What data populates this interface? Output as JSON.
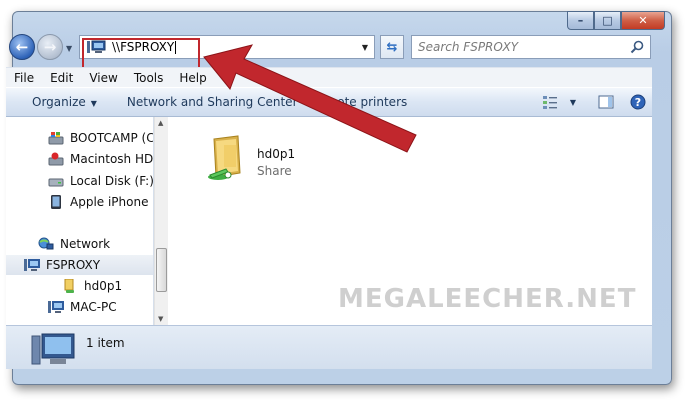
{
  "window": {
    "caption": {
      "minimize": "–",
      "maximize": "□",
      "close": "✕"
    }
  },
  "navigation": {
    "back_icon": "back-arrow-icon",
    "forward_icon": "forward-arrow-icon",
    "address_value": "\\\\FSPROXY",
    "search_placeholder": "Search FSPROXY"
  },
  "menu": [
    "File",
    "Edit",
    "View",
    "Tools",
    "Help"
  ],
  "commands": {
    "organize": "Organize",
    "network_sharing": "Network and Sharing Center",
    "remote_printers": "remote printers"
  },
  "sidebar": {
    "items": [
      {
        "label": "BOOTCAMP (C:)",
        "icon": "windows-drive-icon"
      },
      {
        "label": "Macintosh HD (E",
        "icon": "mac-drive-icon"
      },
      {
        "label": "Local Disk (F:)",
        "icon": "local-disk-icon"
      },
      {
        "label": "Apple iPhone",
        "icon": "phone-icon"
      },
      {
        "label": "Network",
        "icon": "network-globe-icon"
      },
      {
        "label": "FSPROXY",
        "icon": "computer-icon",
        "selected": true
      },
      {
        "label": "hd0p1",
        "icon": "shared-folder-icon"
      },
      {
        "label": "MAC-PC",
        "icon": "computer-icon"
      }
    ]
  },
  "content": {
    "items": [
      {
        "name": "hd0p1",
        "type": "Share"
      }
    ]
  },
  "status": {
    "count_text": "1 item"
  },
  "watermark": "MEGALEECHER.NET",
  "colors": {
    "highlight_box": "#c1272d",
    "arrow": "#c1272d"
  }
}
